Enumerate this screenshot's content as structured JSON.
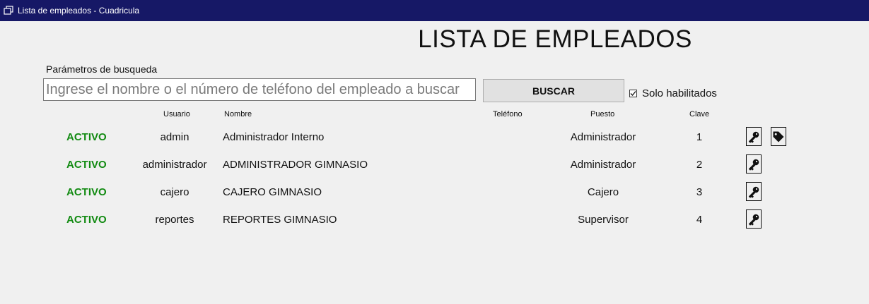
{
  "window": {
    "title": "Lista de empleados - Cuadricula"
  },
  "page": {
    "title": "LISTA DE EMPLEADOS"
  },
  "search": {
    "label": "Parámetros de busqueda",
    "placeholder": "Ingrese el nombre o el número de teléfono del empleado a buscar",
    "button_label": "BUSCAR",
    "only_enabled_label": "Solo habilitados",
    "only_enabled_checked": true
  },
  "table": {
    "headers": [
      "Usuario",
      "Nombre",
      "Teléfono",
      "Puesto",
      "Clave"
    ],
    "rows": [
      {
        "status": "ACTIVO",
        "usuario": "admin",
        "nombre": "Administrador Interno",
        "telefono": "",
        "puesto": "Administrador",
        "clave": "1"
      },
      {
        "status": "ACTIVO",
        "usuario": "administrador",
        "nombre": "ADMINISTRADOR GIMNASIO",
        "telefono": "",
        "puesto": "Administrador",
        "clave": "2"
      },
      {
        "status": "ACTIVO",
        "usuario": "cajero",
        "nombre": "CAJERO GIMNASIO",
        "telefono": "",
        "puesto": "Cajero",
        "clave": "3"
      },
      {
        "status": "ACTIVO",
        "usuario": "reportes",
        "nombre": "REPORTES GIMNASIO",
        "telefono": "",
        "puesto": "Supervisor",
        "clave": "4"
      }
    ],
    "row_actions": [
      [
        "key-icon",
        "tag-icon"
      ],
      [
        "key-icon"
      ],
      [
        "key-icon"
      ],
      [
        "key-icon"
      ]
    ]
  },
  "colors": {
    "titlebar": "#161866",
    "status_active": "#118a11",
    "background": "#f0f0f0"
  }
}
